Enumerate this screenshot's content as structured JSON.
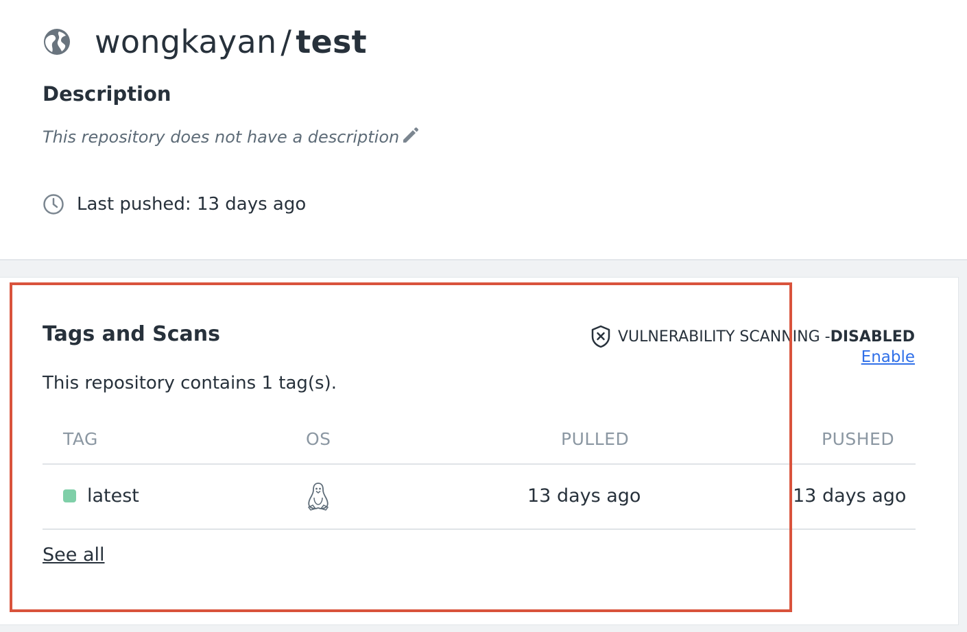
{
  "repo": {
    "namespace": "wongkayan",
    "separator": "/",
    "name": "test"
  },
  "description": {
    "heading": "Description",
    "text": "This repository does not have a description"
  },
  "last_pushed": "Last pushed: 13 days ago",
  "tags_card": {
    "title": "Tags and Scans",
    "scan_label": "VULNERABILITY SCANNING - ",
    "scan_state": "DISABLED",
    "enable_link": "Enable",
    "tag_count_text": "This repository contains 1 tag(s).",
    "columns": [
      "TAG",
      "OS",
      "PULLED",
      "PUSHED"
    ],
    "rows": [
      {
        "tag": "latest",
        "os": "linux-icon",
        "pulled": "13 days ago",
        "pushed": "13 days ago"
      }
    ],
    "see_all": "See all"
  },
  "colors": {
    "highlight": "#d9533c",
    "tag_dot": "#7fcfa8",
    "link": "#2f6fe8"
  }
}
